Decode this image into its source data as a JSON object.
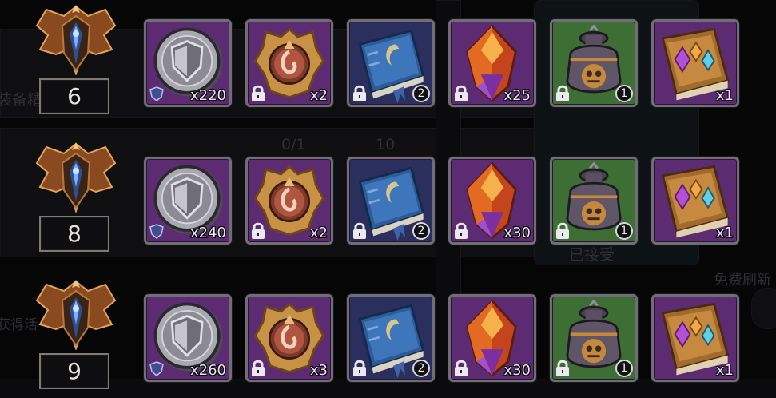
{
  "background": {
    "label_equip": "装备精",
    "label_count": "0/1",
    "label_gems": "10",
    "label_accepted": "已接受",
    "label_free_refresh": "免费刷新",
    "label_obtained": "获得活"
  },
  "rows": [
    {
      "rank": "6",
      "slots": [
        {
          "item": "silver-shield-coin",
          "quantity": "x220",
          "badge": "shield"
        },
        {
          "item": "fire-sigil-crest",
          "quantity": "x2",
          "locked": true
        },
        {
          "item": "moon-spellbook",
          "quantity": "2",
          "locked": true,
          "count_style": "circle"
        },
        {
          "item": "fire-crystal",
          "quantity": "x25",
          "locked": true
        },
        {
          "item": "skull-urn",
          "quantity": "1",
          "locked": true,
          "count_style": "circle"
        },
        {
          "item": "gem-tome",
          "quantity": "x1"
        }
      ]
    },
    {
      "rank": "8",
      "slots": [
        {
          "item": "silver-shield-coin",
          "quantity": "x240",
          "badge": "shield"
        },
        {
          "item": "fire-sigil-crest",
          "quantity": "x2",
          "locked": true
        },
        {
          "item": "moon-spellbook",
          "quantity": "2",
          "locked": true,
          "count_style": "circle"
        },
        {
          "item": "fire-crystal",
          "quantity": "x30",
          "locked": true
        },
        {
          "item": "skull-urn",
          "quantity": "1",
          "locked": true,
          "count_style": "circle"
        },
        {
          "item": "gem-tome",
          "quantity": "x1"
        }
      ]
    },
    {
      "rank": "9",
      "slots": [
        {
          "item": "silver-shield-coin",
          "quantity": "x260",
          "badge": "shield"
        },
        {
          "item": "fire-sigil-crest",
          "quantity": "x3",
          "locked": true
        },
        {
          "item": "moon-spellbook",
          "quantity": "2",
          "locked": true,
          "count_style": "circle"
        },
        {
          "item": "fire-crystal",
          "quantity": "x30",
          "locked": true
        },
        {
          "item": "skull-urn",
          "quantity": "1",
          "locked": true,
          "count_style": "circle"
        },
        {
          "item": "gem-tome",
          "quantity": "x1"
        }
      ]
    }
  ],
  "colors": {
    "slot_purple": "#5d2b72",
    "slot_blue": "#2b2f5e",
    "slot_green": "#3d6e33",
    "slot_border": "#6f6e74",
    "rank_border": "#7f7b73",
    "gold": "#c9944a"
  }
}
